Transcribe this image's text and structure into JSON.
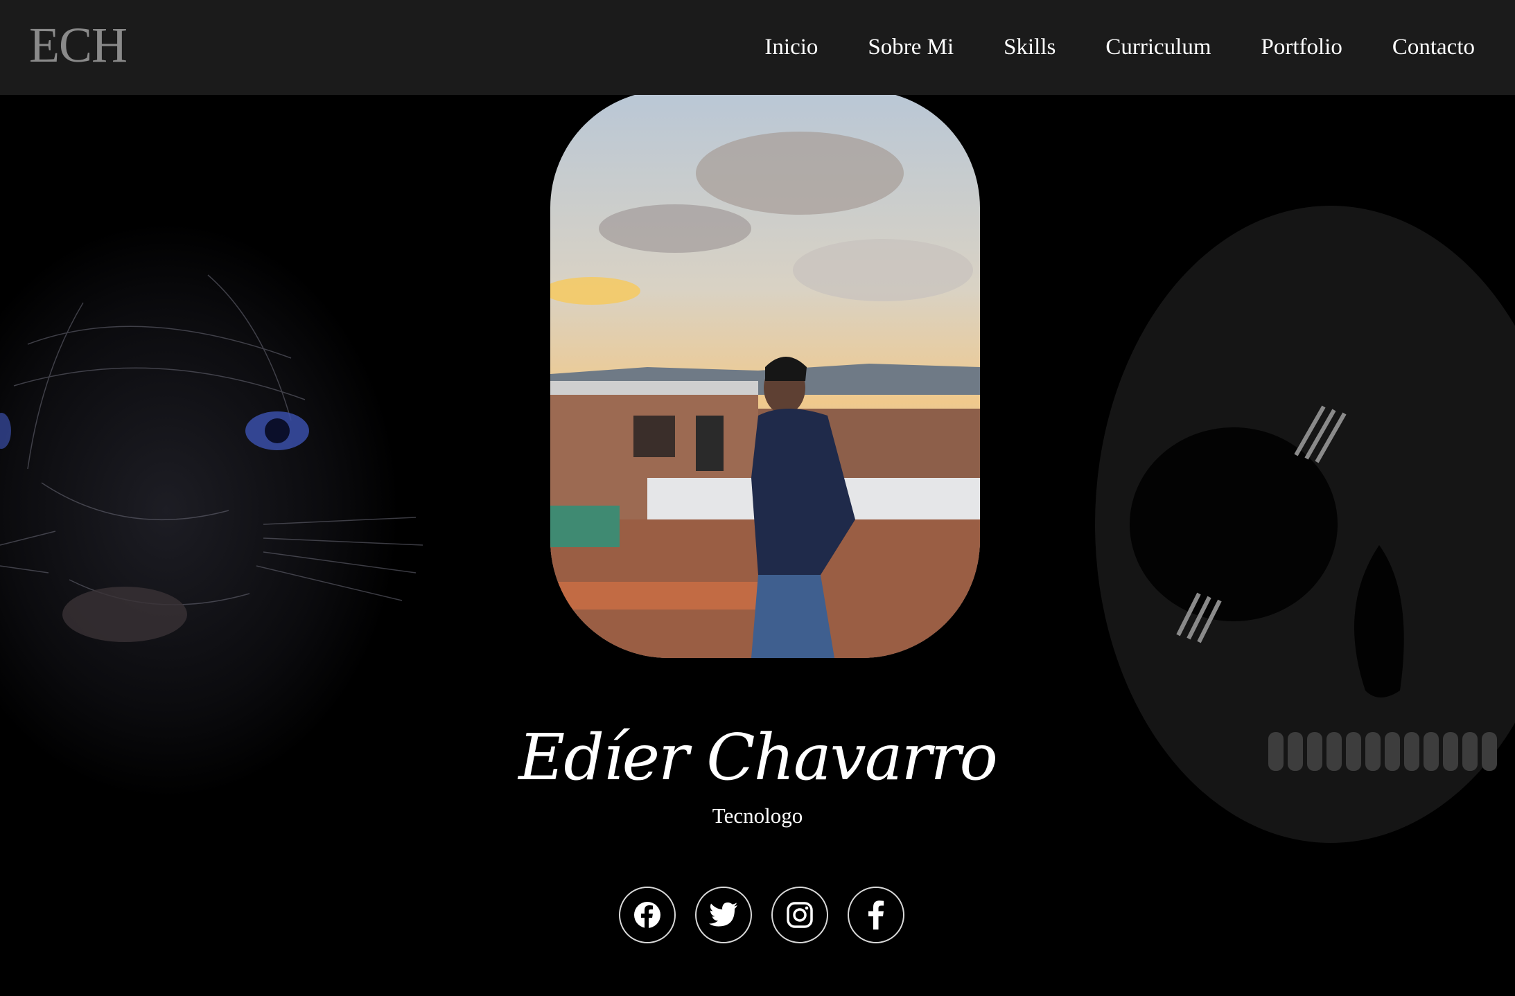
{
  "header": {
    "logo": "ECH",
    "nav": [
      {
        "label": "Inicio"
      },
      {
        "label": "Sobre Mi"
      },
      {
        "label": "Skills"
      },
      {
        "label": "Curriculum"
      },
      {
        "label": "Portfolio"
      },
      {
        "label": "Contacto"
      }
    ]
  },
  "hero": {
    "name": "Edíer Chavarro",
    "subtitle": "Tecnologo"
  },
  "socials": [
    {
      "icon": "facebook-round-icon"
    },
    {
      "icon": "twitter-icon"
    },
    {
      "icon": "instagram-icon"
    },
    {
      "icon": "facebook-f-icon"
    }
  ],
  "colors": {
    "header_bg": "#1b1b1b",
    "page_bg": "#000000",
    "logo": "#8a8a8a",
    "text": "#ffffff"
  }
}
